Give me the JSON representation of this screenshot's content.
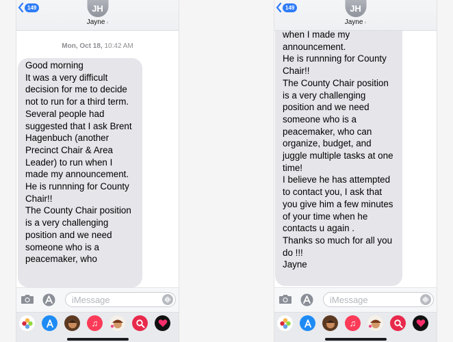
{
  "left": {
    "back_count": "149",
    "avatar_initials": "JH",
    "contact_name": "Jayne",
    "timestamp_date": "Mon, Oct 18,",
    "timestamp_time": "10:42 AM",
    "message": "Good morning\nIt was a very difficult decision for me to decide not to run for a third term.\nSeveral people had suggested that I ask Brent Hagenbuch (another Precinct Chair & Area Leader) to run when I made my announcement.\nHe is runnning for County Chair!!\nThe County Chair position is a very challenging position and we need someone who is a peacemaker, who",
    "input_placeholder": "iMessage"
  },
  "right": {
    "back_count": "149",
    "avatar_initials": "JH",
    "contact_name": "Jayne",
    "message": "when I made my announcement.\nHe is runnning for County Chair!!\nThe County Chair position is a very challenging position and we need someone who is a peacemaker, who can organize, budget, and juggle multiple tasks at one time!\nI believe he has attempted to contact you, I ask that you give him a few minutes of your time when he contacts u again .\nThanks so much for all you do !!!\nJayne",
    "input_placeholder": "iMessage"
  },
  "colors": {
    "accent": "#2f7cf6",
    "bubble_gray": "#e5e5ea",
    "timestamp_gray": "#8e8e93"
  },
  "dock_icons": [
    "photos-icon",
    "app-store-icon",
    "memoji-icon",
    "music-icon",
    "memoji-sticker-icon",
    "image-search-icon",
    "digital-touch-icon"
  ]
}
